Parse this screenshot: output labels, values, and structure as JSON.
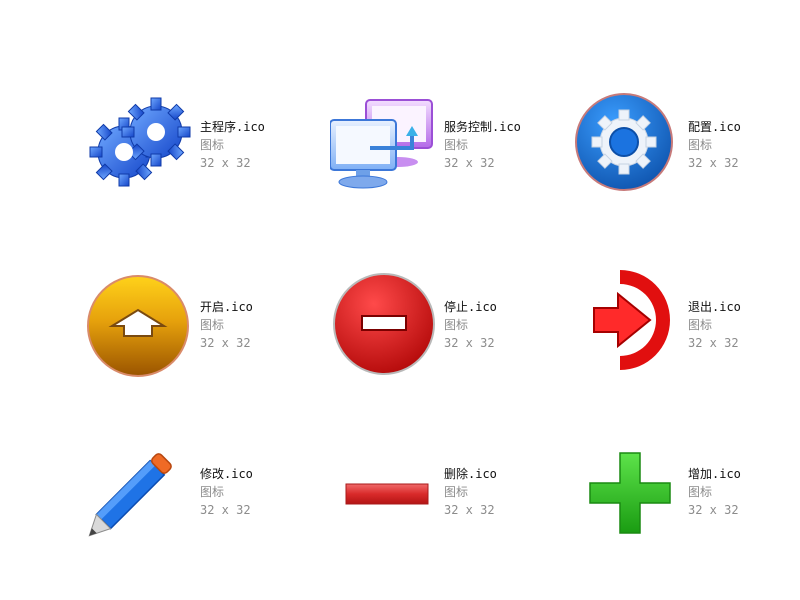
{
  "files": [
    {
      "name": "主程序.ico",
      "type": "图标",
      "dims": "32 x 32",
      "icon": "gears-icon"
    },
    {
      "name": "服务控制.ico",
      "type": "图标",
      "dims": "32 x 32",
      "icon": "monitors-icon"
    },
    {
      "name": "配置.ico",
      "type": "图标",
      "dims": "32 x 32",
      "icon": "gear-circle-icon"
    },
    {
      "name": "开启.ico",
      "type": "图标",
      "dims": "32 x 32",
      "icon": "up-arrow-circle-icon"
    },
    {
      "name": "停止.ico",
      "type": "图标",
      "dims": "32 x 32",
      "icon": "minus-circle-icon"
    },
    {
      "name": "退出.ico",
      "type": "图标",
      "dims": "32 x 32",
      "icon": "exit-arrow-icon"
    },
    {
      "name": "修改.ico",
      "type": "图标",
      "dims": "32 x 32",
      "icon": "pencil-icon"
    },
    {
      "name": "删除.ico",
      "type": "图标",
      "dims": "32 x 32",
      "icon": "minus-bar-icon"
    },
    {
      "name": "增加.ico",
      "type": "图标",
      "dims": "32 x 32",
      "icon": "plus-icon"
    }
  ]
}
